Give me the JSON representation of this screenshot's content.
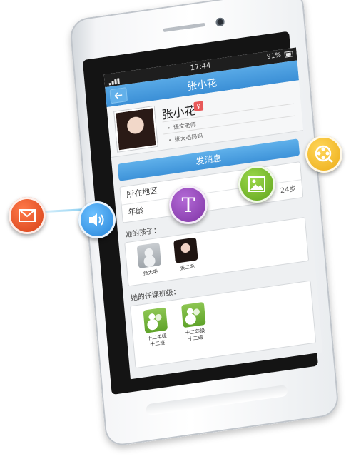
{
  "status_bar": {
    "time": "17:44",
    "battery": "91%"
  },
  "header": {
    "title": "张小花"
  },
  "profile": {
    "name": "张小花",
    "lines": [
      "语文老师",
      "张大毛妈妈"
    ]
  },
  "actions": {
    "send_message": "发消息"
  },
  "info_rows": [
    {
      "label": "所在地区",
      "value": ""
    },
    {
      "label": "年龄",
      "value": "24岁"
    }
  ],
  "children_section": {
    "label": "她的孩子：",
    "children": [
      "张大毛",
      "张二毛"
    ]
  },
  "classes_section": {
    "label": "她的任课班级：",
    "classes": [
      {
        "line1": "十二年级",
        "line2": "十二班"
      },
      {
        "line1": "十二年级",
        "line2": "十二班"
      }
    ]
  },
  "floating_icons": [
    {
      "name": "mail-icon",
      "color": "#e04a1f"
    },
    {
      "name": "speaker-icon",
      "color": "#2e8fe0"
    },
    {
      "name": "text-icon",
      "color": "#8d3fb0",
      "glyph": "T"
    },
    {
      "name": "image-icon",
      "color": "#6fb321"
    },
    {
      "name": "video-icon",
      "color": "#f3b81a"
    }
  ],
  "colors": {
    "accent": "#3b8fd6",
    "green": "#6fb321"
  }
}
